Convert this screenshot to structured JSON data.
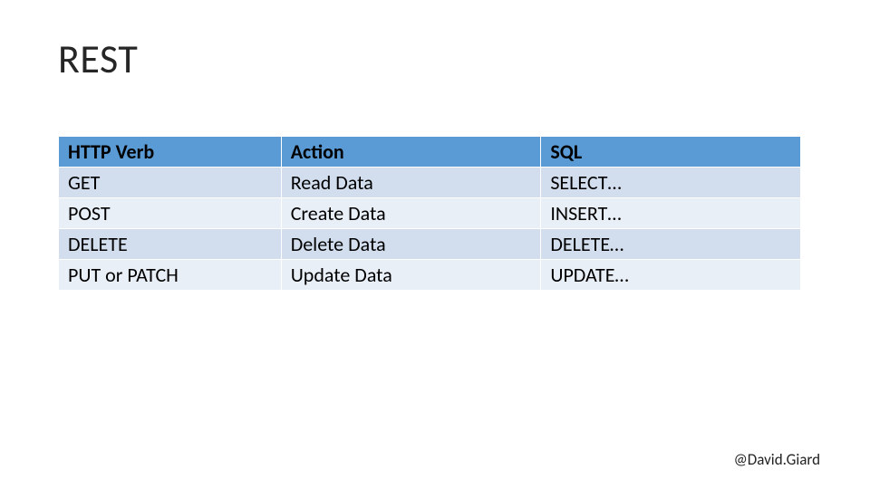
{
  "title": "REST",
  "table": {
    "headers": [
      "HTTP Verb",
      "Action",
      "SQL"
    ],
    "rows": [
      {
        "verb": "GET",
        "action": "Read Data",
        "sql": "SELECT…"
      },
      {
        "verb": "POST",
        "action": "Create Data",
        "sql": "INSERT…"
      },
      {
        "verb": "DELETE",
        "action": "Delete Data",
        "sql": "DELETE…"
      },
      {
        "verb": "PUT or PATCH",
        "action": "Update Data",
        "sql": "UPDATE…"
      }
    ]
  },
  "footer": "@David.Giard"
}
